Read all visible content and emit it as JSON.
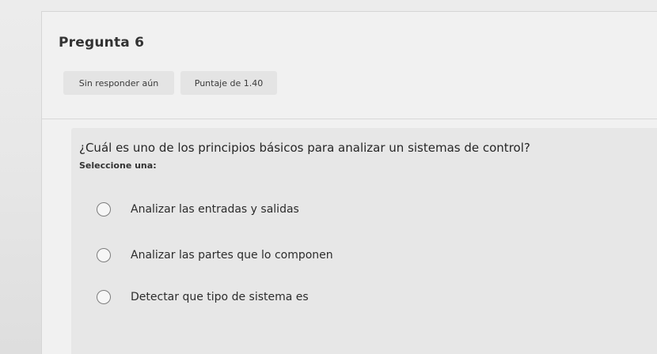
{
  "question": {
    "title": "Pregunta 6",
    "status": "Sin responder aún",
    "score": "Puntaje de 1.40",
    "text": "¿Cuál es uno de los principios básicos para analizar un sistemas de control?",
    "select_label": "Seleccione una:",
    "options": [
      {
        "label": "Analizar las entradas y salidas"
      },
      {
        "label": "Analizar las partes que lo componen"
      },
      {
        "label": "Detectar que tipo de sistema es"
      }
    ]
  }
}
